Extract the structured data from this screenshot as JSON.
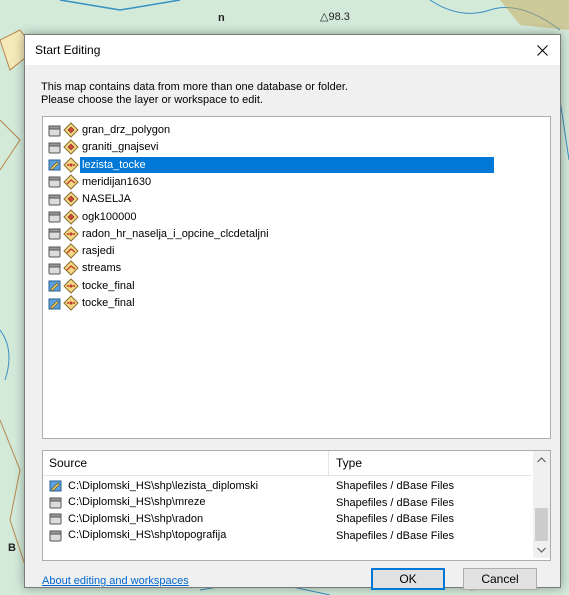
{
  "dialog": {
    "title": "Start Editing",
    "intro_line1": "This map contains data from more than one database or folder.",
    "intro_line2": "Please choose the layer or workspace to edit."
  },
  "layers": [
    {
      "name": "gran_drz_polygon",
      "editable": false,
      "symbol": "polygon"
    },
    {
      "name": "graniti_gnajsevi",
      "editable": false,
      "symbol": "polygon"
    },
    {
      "name": "lezista_tocke",
      "editable": true,
      "symbol": "point",
      "selected": true
    },
    {
      "name": "meridijan1630",
      "editable": false,
      "symbol": "line"
    },
    {
      "name": "NASELJA",
      "editable": false,
      "symbol": "polygon"
    },
    {
      "name": "ogk100000",
      "editable": false,
      "symbol": "polygon"
    },
    {
      "name": "radon_hr_naselja_i_opcine_clcdetaljni",
      "editable": false,
      "symbol": "point"
    },
    {
      "name": "rasjedi",
      "editable": false,
      "symbol": "line"
    },
    {
      "name": "streams",
      "editable": false,
      "symbol": "line"
    },
    {
      "name": "tocke_final",
      "editable": true,
      "symbol": "point"
    },
    {
      "name": "tocke_final",
      "editable": true,
      "symbol": "point"
    }
  ],
  "source_table": {
    "headers": {
      "source": "Source",
      "type": "Type"
    },
    "rows": [
      {
        "source": "C:\\Diplomski_HS\\shp\\lezista_diplomski",
        "type": "Shapefiles / dBase Files",
        "editable": true
      },
      {
        "source": "C:\\Diplomski_HS\\shp\\mreze",
        "type": "Shapefiles / dBase Files",
        "editable": false
      },
      {
        "source": "C:\\Diplomski_HS\\shp\\radon",
        "type": "Shapefiles / dBase Files",
        "editable": false
      },
      {
        "source": "C:\\Diplomski_HS\\shp\\topografija",
        "type": "Shapefiles / dBase Files",
        "editable": false
      }
    ]
  },
  "footer": {
    "help_link": "About editing and workspaces",
    "ok_label": "OK",
    "cancel_label": "Cancel"
  },
  "map_labels": {
    "label_a": "n",
    "label_b": "98.3",
    "label_c": "B"
  },
  "colors": {
    "selection": "#0078d7",
    "link": "#0066cc",
    "map_bg": "#d3ead9"
  }
}
